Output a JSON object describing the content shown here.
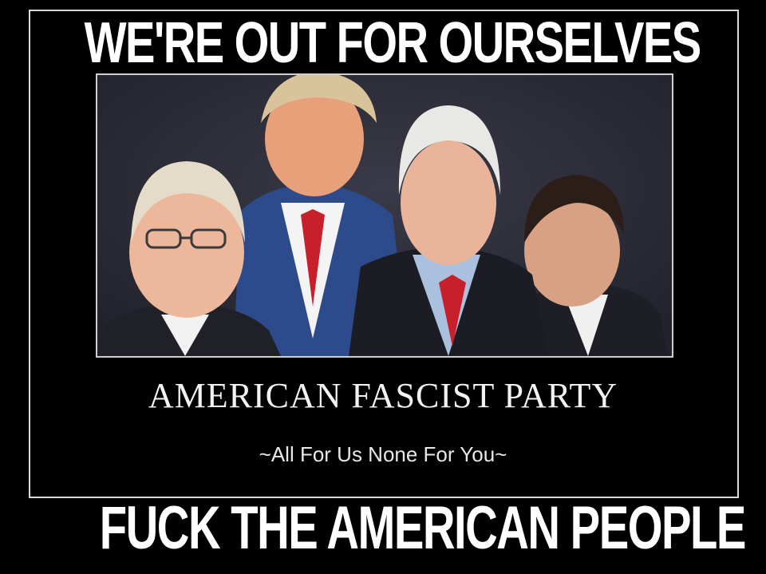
{
  "top_caption": "WE'RE OUT FOR OURSELVES",
  "title": "AMERICAN FASCIST PARTY",
  "subtitle": "~All For Us None For You~",
  "bottom_caption": "FUCK THE AMERICAN PEOPLE",
  "colors": {
    "background": "#000000",
    "frame": "#d9d9d9",
    "photo_background": "#2a2a35",
    "text": "#ffffff"
  }
}
